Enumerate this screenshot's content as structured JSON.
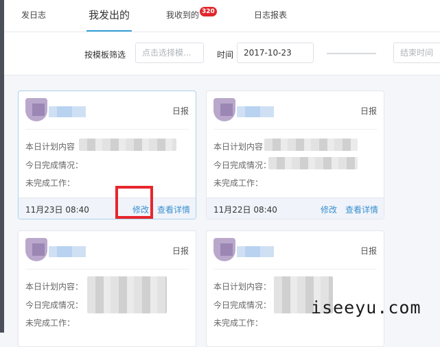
{
  "tabs": [
    {
      "label": "发日志"
    },
    {
      "label": "我发出的"
    },
    {
      "label": "我收到的",
      "badge": "320"
    },
    {
      "label": "日志报表"
    }
  ],
  "filter": {
    "template_label": "按模板筛选",
    "template_placeholder": "点击选择模...",
    "time_label": "时间",
    "start_date": "2017-10-23",
    "end_placeholder": "结束时间"
  },
  "cards": [
    {
      "type": "日报",
      "lines": [
        "本日计划内容",
        "今日完成情况：",
        "未完成工作："
      ],
      "time": "11月23日 08:40",
      "edit": "修改",
      "view": "查看详情"
    },
    {
      "type": "日报",
      "lines": [
        "本日计划内容",
        "今日完成情况：",
        "未完成工作："
      ],
      "time": "11月22日 08:40",
      "edit": "修改",
      "view": "查看详情"
    },
    {
      "type": "日报",
      "lines": [
        "本日计划内容：",
        "今日完成情况：",
        "未完成工作："
      ]
    },
    {
      "type": "日报",
      "lines": [
        "本日计划内容：",
        "今日完成情况：",
        "未完成工作："
      ]
    }
  ],
  "watermark": "iseeyu.com",
  "colors": {
    "accent": "#35a2d8",
    "link": "#3a8fd0",
    "highlight": "#e8252d",
    "badge": "#e0262c"
  }
}
